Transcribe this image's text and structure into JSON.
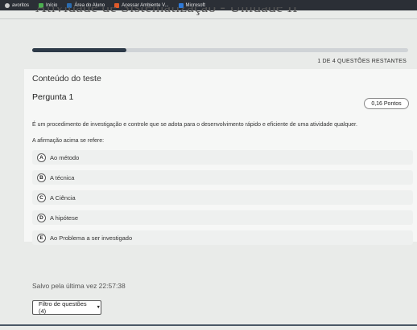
{
  "favorites": [
    {
      "label": "avoritos",
      "icon": "star-icon",
      "color": "#cccccc"
    },
    {
      "label": "Início",
      "icon": "home-icon",
      "color": "#4caf50"
    },
    {
      "label": "Área do Aluno",
      "icon": "page-icon",
      "color": "#2b6cb0"
    },
    {
      "label": "Acessar Ambiente V...",
      "icon": "lambda-icon",
      "color": "#e05a2a"
    },
    {
      "label": "Microsoft",
      "icon": "microsoft-icon",
      "color": "#2f7ad8"
    }
  ],
  "page_title": "Atividade de Sistematização - Unidade II",
  "progress": {
    "fraction": 0.25,
    "label": "1 DE 4 QUESTÕES RESTANTES"
  },
  "section_title": "Conteúdo do teste",
  "question": {
    "title": "Pergunta 1",
    "points": "0,16 Pontos",
    "statement": "É um procedimento de investigação e controle que se adota para o desenvolvimento rápido e eficiente de uma atividade qualquer.",
    "prompt": "A afirmação acima se refere:",
    "options": [
      {
        "letter": "A",
        "text": "Ao método"
      },
      {
        "letter": "B",
        "text": "A técnica"
      },
      {
        "letter": "C",
        "text": "A Ciência"
      },
      {
        "letter": "D",
        "text": "A hipótese"
      },
      {
        "letter": "E",
        "text": "Ao Problema a ser investigado"
      }
    ]
  },
  "saved_text": "Salvo pela última vez 22:57:38",
  "filter": {
    "label": "Filtro de questões (4)"
  }
}
